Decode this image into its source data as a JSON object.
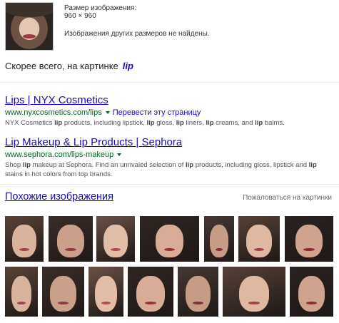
{
  "image_info": {
    "size_label": "Размер изображения:",
    "size_value": "960 × 960",
    "no_other_sizes": "Изображения других размеров не найдены."
  },
  "best_guess": {
    "label": "Скорее всего, на картинке",
    "query": "lip"
  },
  "results": [
    {
      "title": "Lips | NYX Cosmetics",
      "url": "www.nyxcosmetics.com/lips",
      "translate": "Перевести эту страницу",
      "snippet_parts": [
        [
          "NYX Cosmetics ",
          false
        ],
        [
          "lip",
          true
        ],
        [
          " products, including lipstick, ",
          false
        ],
        [
          "lip",
          true
        ],
        [
          " gloss, ",
          false
        ],
        [
          "lip",
          true
        ],
        [
          " liners, ",
          false
        ],
        [
          "lip",
          true
        ],
        [
          " creams, and ",
          false
        ],
        [
          "lip",
          true
        ],
        [
          " balms.",
          false
        ]
      ]
    },
    {
      "title": "Lip Makeup & Lip Products | Sephora",
      "url": "www.sephora.com/lips-makeup",
      "translate": "",
      "snippet_parts": [
        [
          "Shop ",
          false
        ],
        [
          "lip",
          true
        ],
        [
          " makeup at Sephora. Find an unrivaled selection of ",
          false
        ],
        [
          "lip",
          true
        ],
        [
          " products, including gloss, lipstick and ",
          false
        ],
        [
          "lip",
          true
        ],
        [
          " stains in hot colors from top brands.",
          false
        ]
      ]
    }
  ],
  "similar": {
    "title": "Похожие изображения",
    "report": "Пожаловаться на картинки"
  },
  "colors": {
    "link": "#1a0dab",
    "url_green": "#006621",
    "snippet": "#545454"
  }
}
